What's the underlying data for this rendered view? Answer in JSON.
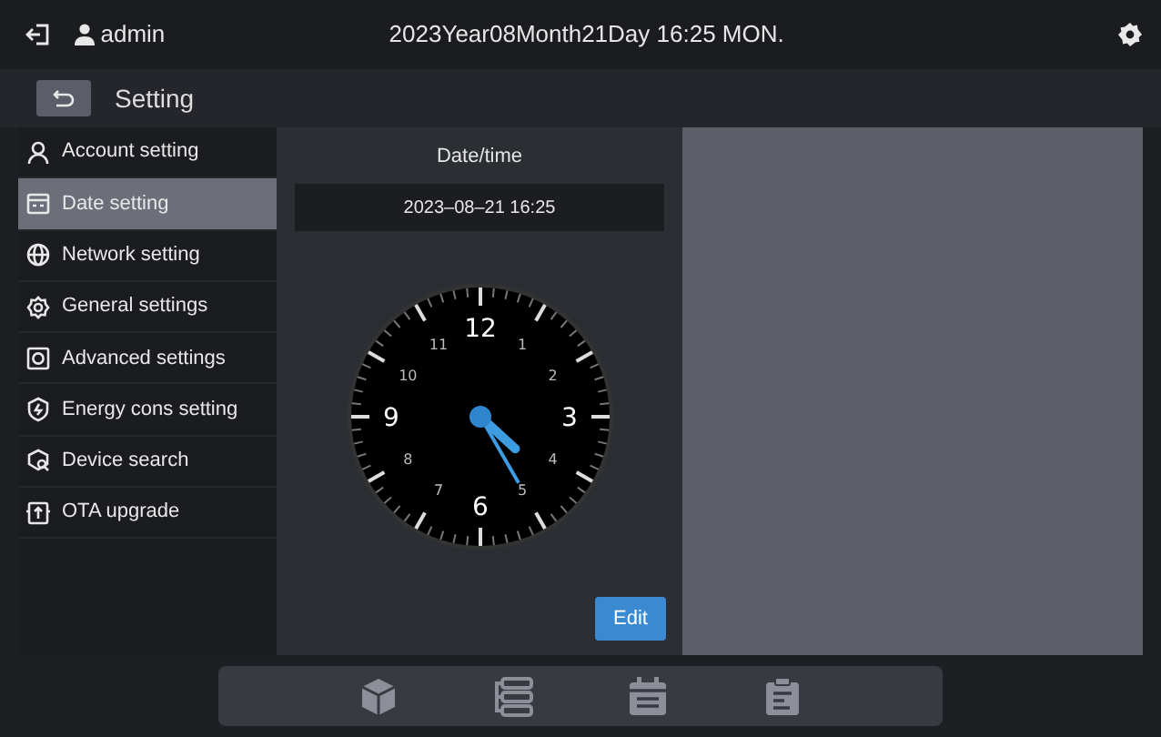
{
  "header": {
    "user": "admin",
    "datetime": "2023Year08Month21Day 16:25 MON."
  },
  "subheader": {
    "title": "Setting"
  },
  "sidebar": {
    "items": [
      {
        "label": "Account setting",
        "selected": false
      },
      {
        "label": "Date setting",
        "selected": true
      },
      {
        "label": "Network setting",
        "selected": false
      },
      {
        "label": "General settings",
        "selected": false
      },
      {
        "label": "Advanced settings",
        "selected": false
      },
      {
        "label": "Energy cons setting",
        "selected": false
      },
      {
        "label": "Device search",
        "selected": false
      },
      {
        "label": "OTA upgrade",
        "selected": false
      }
    ]
  },
  "panel": {
    "title": "Date/time",
    "value": "2023–08–21 16:25",
    "clock": {
      "numerals": [
        "12",
        "1",
        "2",
        "3",
        "4",
        "5",
        "6",
        "7",
        "8",
        "9",
        "10",
        "11"
      ]
    },
    "button": "Edit"
  }
}
